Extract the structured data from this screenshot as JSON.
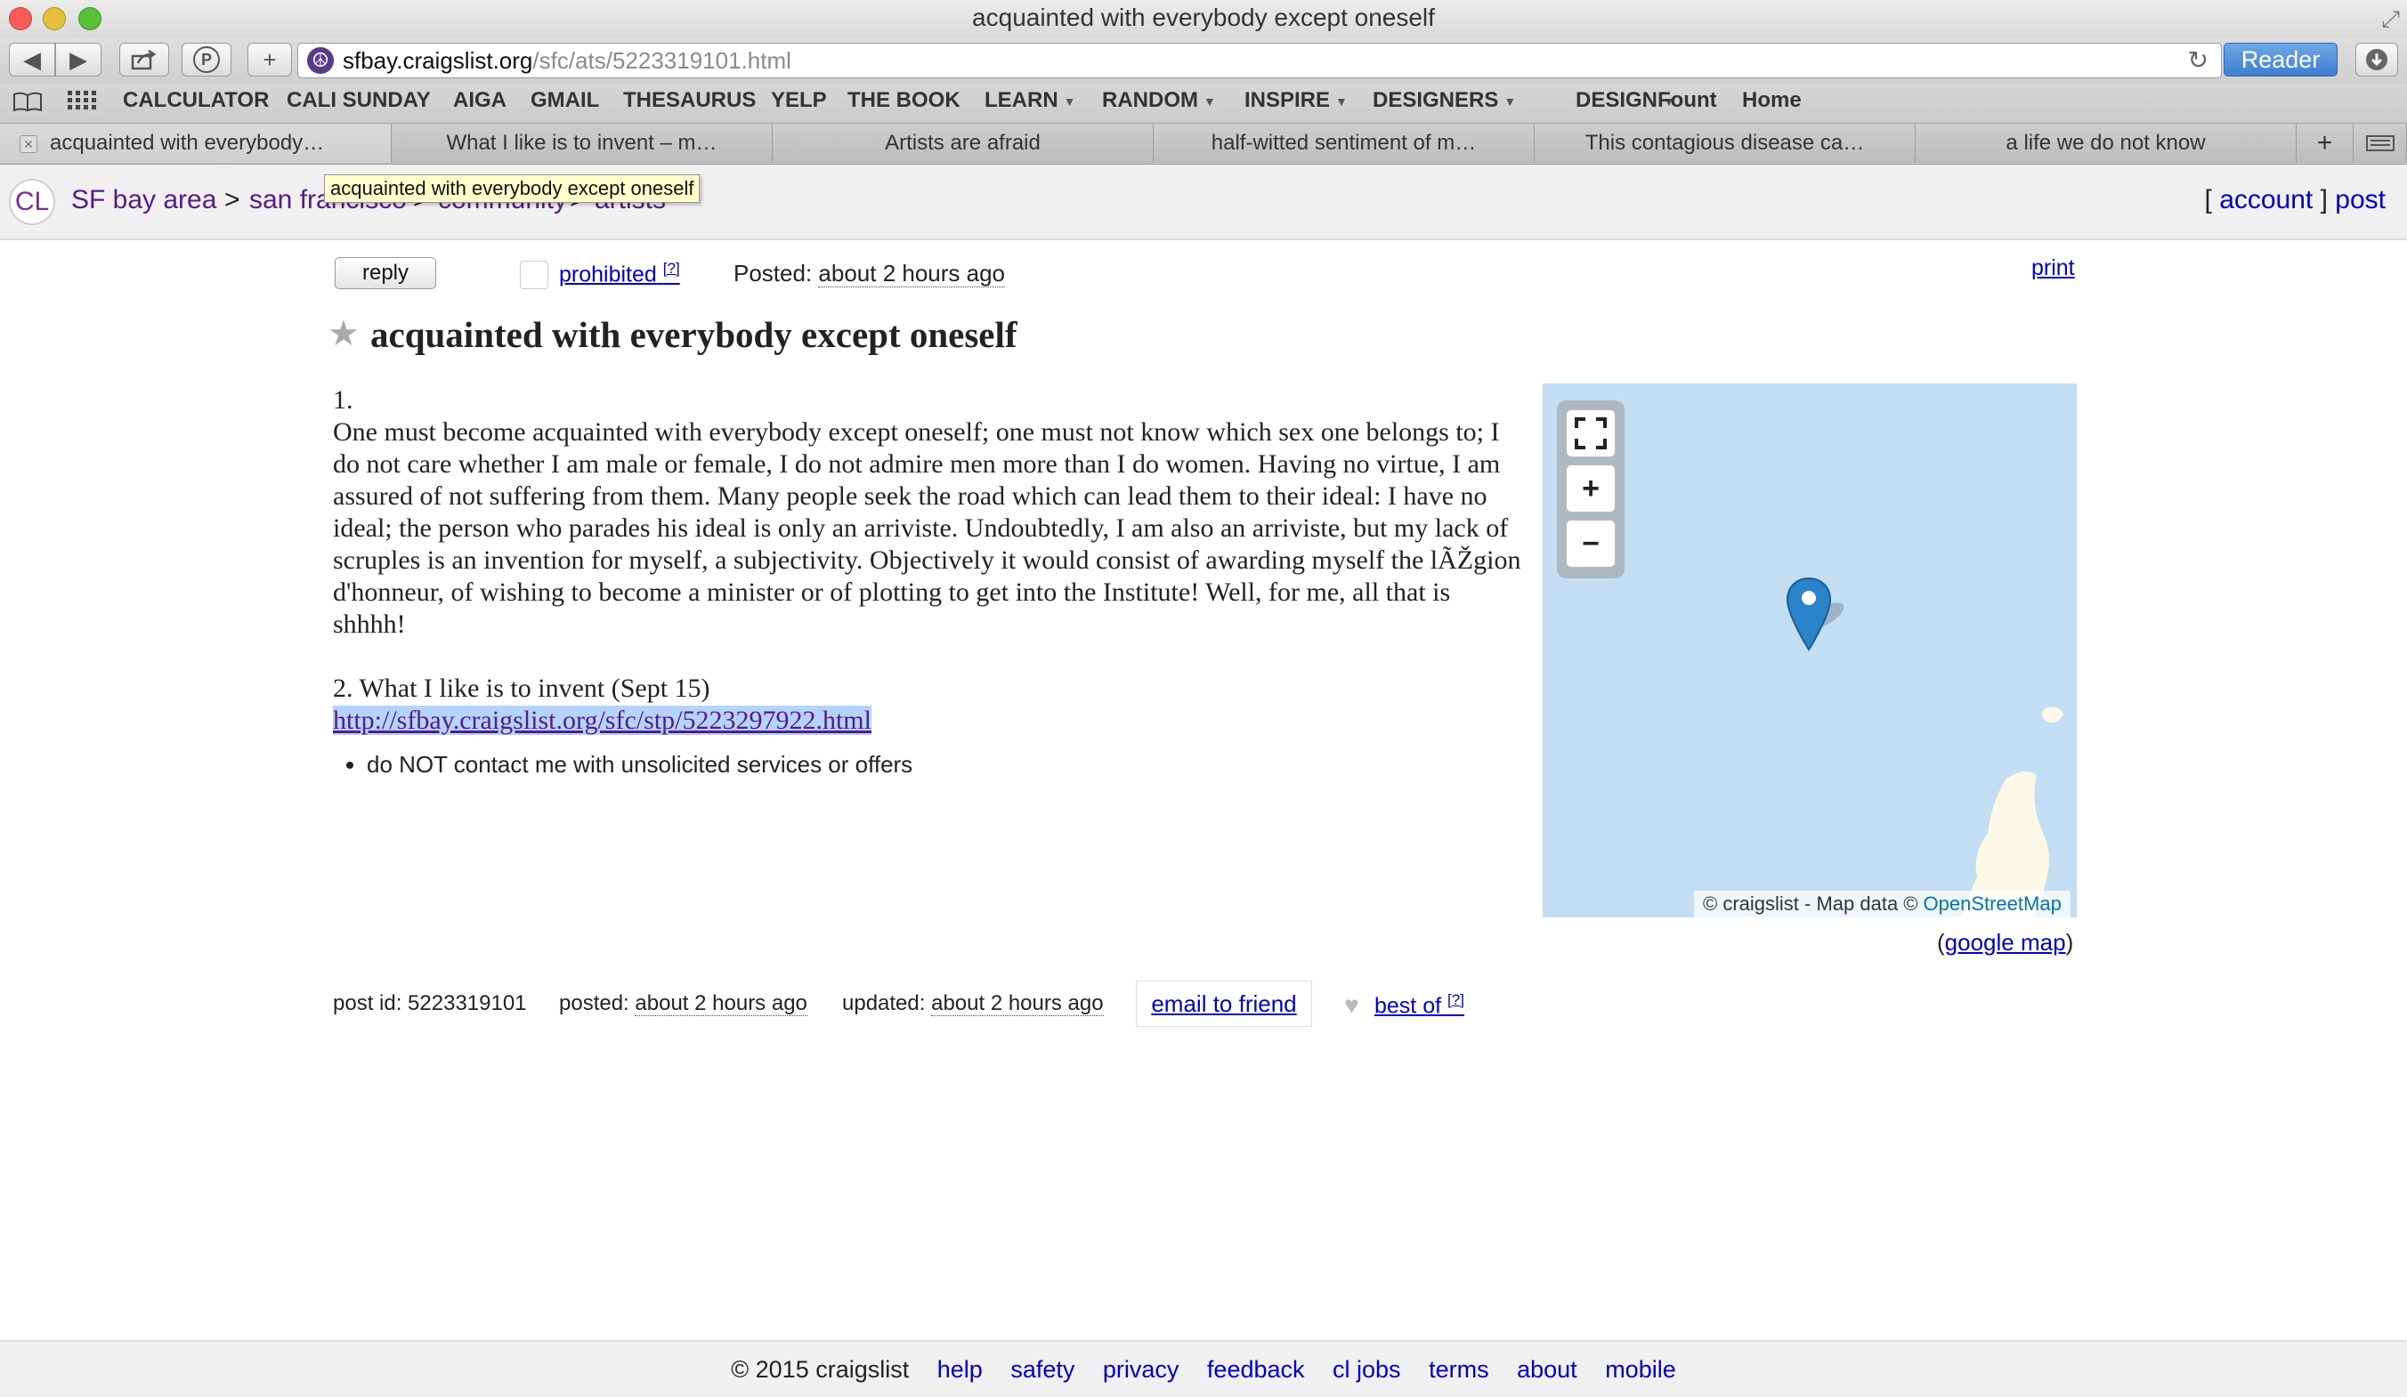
{
  "window": {
    "title": "acquainted with everybody except oneself",
    "colors": {
      "close": "#fc5b57",
      "minimize": "#e5bf3c",
      "zoom": "#57c038"
    }
  },
  "toolbar": {
    "back_icon": "back-arrow-icon",
    "forward_icon": "forward-arrow-icon",
    "url_host": "sfbay.craigslist.org",
    "url_path": "/sfc/ats/5223319101.html",
    "reader_label": "Reader"
  },
  "bookmarks": [
    {
      "label": "CALCULATOR",
      "menu": false
    },
    {
      "label": "CALI SUNDAY",
      "menu": false
    },
    {
      "label": "AIGA",
      "menu": false
    },
    {
      "label": "GMAIL",
      "menu": false
    },
    {
      "label": "THESAURUS",
      "menu": false
    },
    {
      "label": "YELP",
      "menu": false
    },
    {
      "label": "THE BOOK",
      "menu": false
    },
    {
      "label": "LEARN",
      "menu": true
    },
    {
      "label": "RANDOM",
      "menu": true
    },
    {
      "label": "INSPIRE",
      "menu": true
    },
    {
      "label": "DESIGNERS",
      "menu": true
    },
    {
      "label": "DESIGN",
      "menu": true
    },
    {
      "label": "Fount",
      "menu": false
    },
    {
      "label": "Home",
      "menu": false
    }
  ],
  "tabs": [
    {
      "label": "acquainted with everybody…",
      "active": true
    },
    {
      "label": "What I like is to invent – m…",
      "active": false
    },
    {
      "label": "Artists are afraid",
      "active": false
    },
    {
      "label": "half-witted sentiment of m…",
      "active": false
    },
    {
      "label": "This contagious disease ca…",
      "active": false
    },
    {
      "label": "a life we do not know",
      "active": false
    }
  ],
  "header": {
    "logo": "CL",
    "breadcrumb": [
      "SF bay area",
      "san francisco",
      "community",
      "artists"
    ],
    "separator": ">",
    "tooltip": "acquainted with everybody except oneself",
    "account_label": "account",
    "post_label": "post"
  },
  "posting": {
    "reply_label": "reply",
    "prohibited_label": "prohibited",
    "help_sup": "[?]",
    "posted_prefix": "Posted:",
    "posted_time": "about 2 hours ago",
    "print_label": "print",
    "title": "acquainted with everybody except oneself",
    "body_1_number": "1.",
    "body_1_text": "One must become acquainted with everybody except oneself; one must not know which sex one belongs to; I do not care whether I am male or female, I do not admire men more than I do women. Having no virtue, I am assured of not suffering from them. Many people seek the road which can lead them to their ideal: I have no ideal; the person who parades his ideal is only an arriviste. Undoubtedly, I am also an arriviste, but my lack of scruples is an invention for myself, a subjectivity. Objectively it would consist of awarding myself the lÃŽgion d'honneur, of wishing to become a minister or of plotting to get into the Institute! Well, for me, all that is shhhh!",
    "body_2_heading": "2. What I like is to invent (Sept 15)",
    "body_2_link": "http://sfbay.craigslist.org/sfc/stp/5223297922.html",
    "notices": [
      "do NOT contact me with unsolicited services or offers"
    ]
  },
  "map": {
    "fullscreen_icon": "fullscreen-icon",
    "zoom_in": "+",
    "zoom_out": "−",
    "attribution_prefix": "© craigslist - Map data ©",
    "attribution_link": "OpenStreetMap",
    "google_map_label": "google map",
    "water_color": "#c3ddf3",
    "land_color": "#fbf8e6",
    "pin_color": "#2b83c9"
  },
  "post_info": {
    "post_id": "post id: 5223319101",
    "posted_prefix": "posted:",
    "posted_time": "about 2 hours ago",
    "updated_prefix": "updated:",
    "updated_time": "about 2 hours ago",
    "email_label": "email to friend",
    "best_of_label": "best of",
    "help_sup": "[?]"
  },
  "footer": {
    "copyright": "© 2015 craigslist",
    "links": [
      "help",
      "safety",
      "privacy",
      "feedback",
      "cl jobs",
      "terms",
      "about",
      "mobile"
    ]
  }
}
